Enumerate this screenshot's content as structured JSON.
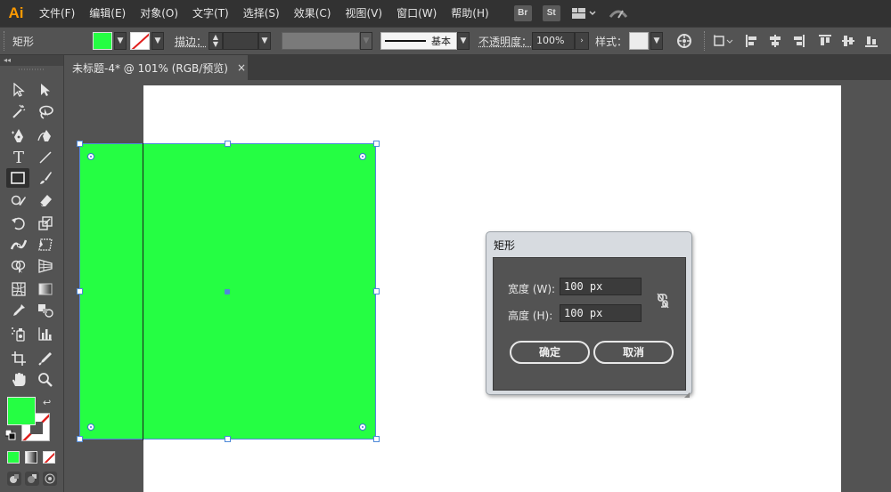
{
  "app": {
    "logo": "Ai"
  },
  "menu": [
    "文件(F)",
    "编辑(E)",
    "对象(O)",
    "文字(T)",
    "选择(S)",
    "效果(C)",
    "视图(V)",
    "窗口(W)",
    "帮助(H)"
  ],
  "menubar_buttons": {
    "bridge": "Br",
    "stock": "St"
  },
  "control_bar": {
    "object_type": "矩形",
    "stroke_label": "描边：",
    "brush_label": "基本",
    "opacity_label": "不透明度：",
    "opacity_value": "100%",
    "style_label": "样式："
  },
  "document_tab": {
    "title": "未标题-4* @ 101% (RGB/预览)",
    "close": "×"
  },
  "dialog": {
    "title": "矩形",
    "width_label": "宽度 (W):",
    "width_value": "100 px",
    "height_label": "高度 (H):",
    "height_value": "100 px",
    "ok_label": "确定",
    "cancel_label": "取消"
  },
  "colors": {
    "fill": "#25fe43",
    "selection": "#4f89d8",
    "logo": "#ff9a00",
    "none_slash": "#e0201e"
  },
  "icons": {
    "toolbar": [
      "selection-tool-icon",
      "direct-selection-tool-icon",
      "magic-wand-icon",
      "lasso-icon",
      "pen-tool-icon",
      "curvature-tool-icon",
      "type-tool-icon",
      "line-segment-icon",
      "rectangle-tool-icon",
      "paintbrush-icon",
      "shaper-tool-icon",
      "eraser-icon",
      "rotate-tool-icon",
      "scale-tool-icon",
      "width-tool-icon",
      "free-transform-icon",
      "shape-builder-icon",
      "perspective-grid-icon",
      "mesh-tool-icon",
      "gradient-tool-icon",
      "eyedropper-icon",
      "blend-tool-icon",
      "symbol-sprayer-icon",
      "column-graph-icon",
      "artboard-tool-icon",
      "slice-tool-icon",
      "hand-tool-icon",
      "zoom-tool-icon"
    ]
  }
}
